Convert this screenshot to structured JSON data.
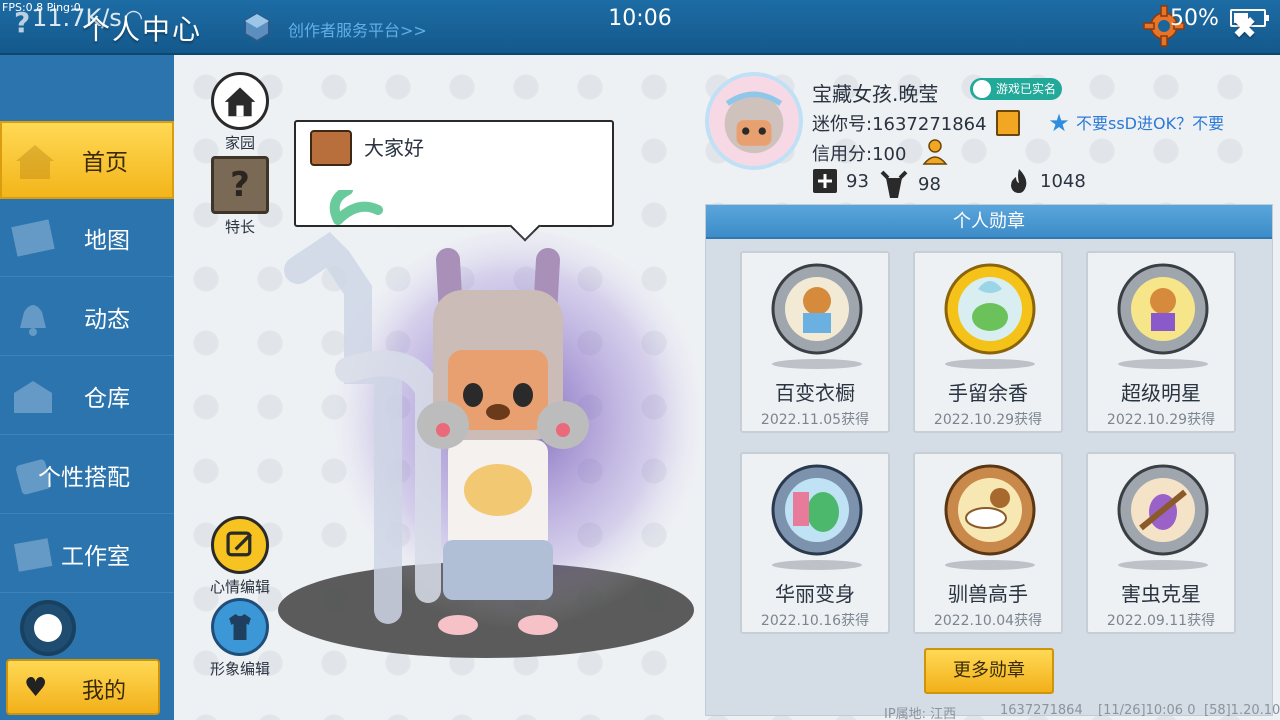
{
  "topbar": {
    "debug": "FPS:0.8  Ping:0",
    "netspeed": "11.7K/s",
    "title": "个人中心",
    "creator_link": "创作者服务平台>>",
    "time": "10:06",
    "battery": "50%"
  },
  "sidebar": {
    "items": [
      {
        "label": "首页",
        "icon": "home-icon",
        "active": true
      },
      {
        "label": "地图",
        "icon": "map-icon"
      },
      {
        "label": "动态",
        "icon": "bell-icon"
      },
      {
        "label": "仓库",
        "icon": "warehouse-icon"
      },
      {
        "label": "个性搭配",
        "icon": "outfit-icon"
      },
      {
        "label": "工作室",
        "icon": "studio-icon"
      }
    ],
    "mine_label": "我的"
  },
  "actions": {
    "home": "家园",
    "skill": "特长",
    "mood": "心情编辑",
    "look": "形象编辑"
  },
  "speech": {
    "text": "大家好"
  },
  "profile": {
    "nickname": "宝藏女孩.晚莹",
    "verified": "游戏已实名",
    "mini_id": "迷你号:1637271864",
    "signature": "不要ssD进OK？不要",
    "credit": "信用分:100",
    "stats": [
      {
        "icon": "plus-icon",
        "value": "93"
      },
      {
        "icon": "trophy-icon",
        "value": "98"
      },
      {
        "icon": "flame-icon",
        "value": "1048"
      }
    ]
  },
  "medals": {
    "header": "个人勋章",
    "items": [
      {
        "name": "百变衣橱",
        "date": "2022.11.05获得",
        "color": "#9fa6ad"
      },
      {
        "name": "手留余香",
        "date": "2022.10.29获得",
        "color": "#f5c21a"
      },
      {
        "name": "超级明星",
        "date": "2022.10.29获得",
        "color": "#9fa6ad"
      },
      {
        "name": "华丽变身",
        "date": "2022.10.16获得",
        "color": "#7d93ad"
      },
      {
        "name": "驯兽高手",
        "date": "2022.10.04获得",
        "color": "#c8894a"
      },
      {
        "name": "害虫克星",
        "date": "2022.09.11获得",
        "color": "#9fa6ad"
      }
    ],
    "more": "更多勋章"
  },
  "footer": {
    "ip": "IP属地: 江西",
    "uid": "1637271864",
    "stamp": "[11/26]10:06 0",
    "version": "[58]1.20.10"
  },
  "colors": {
    "accent": "#f3b51a",
    "topbar": "#1a659c",
    "sidebar": "#2b74ad"
  }
}
